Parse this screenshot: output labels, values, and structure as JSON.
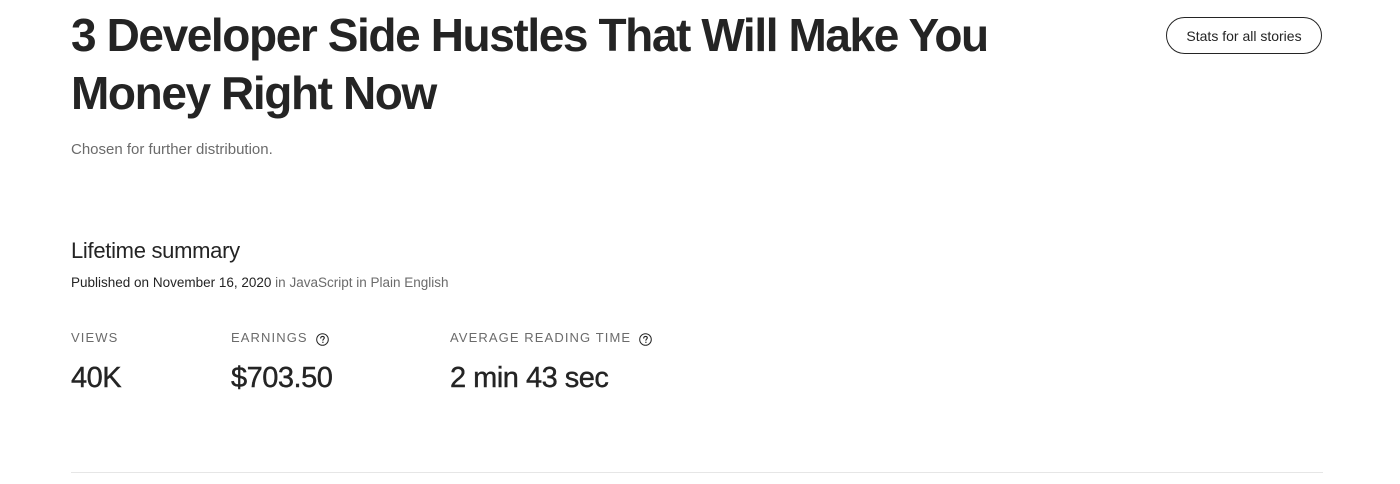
{
  "story": {
    "title": "3 Developer Side Hustles That Will Make You Money Right Now",
    "distribution_note": "Chosen for further distribution."
  },
  "header": {
    "stats_all_label": "Stats for all stories"
  },
  "summary": {
    "heading": "Lifetime summary",
    "published_prefix": "Published on",
    "published_date": "November 16, 2020",
    "publication_connector": "in",
    "publication_name": "JavaScript in Plain English"
  },
  "metrics": [
    {
      "label": "VIEWS",
      "value": "40K",
      "has_help_icon": false
    },
    {
      "label": "EARNINGS",
      "value": "$703.50",
      "has_help_icon": true,
      "icon": "help-circle-icon"
    },
    {
      "label": "AVERAGE READING TIME",
      "value": "2 min 43 sec",
      "has_help_icon": true,
      "icon": "help-circle-icon"
    }
  ],
  "colors": {
    "text_primary": "#242424",
    "text_secondary": "#6b6b6b",
    "divider": "#e6e6e6",
    "background": "#ffffff"
  }
}
